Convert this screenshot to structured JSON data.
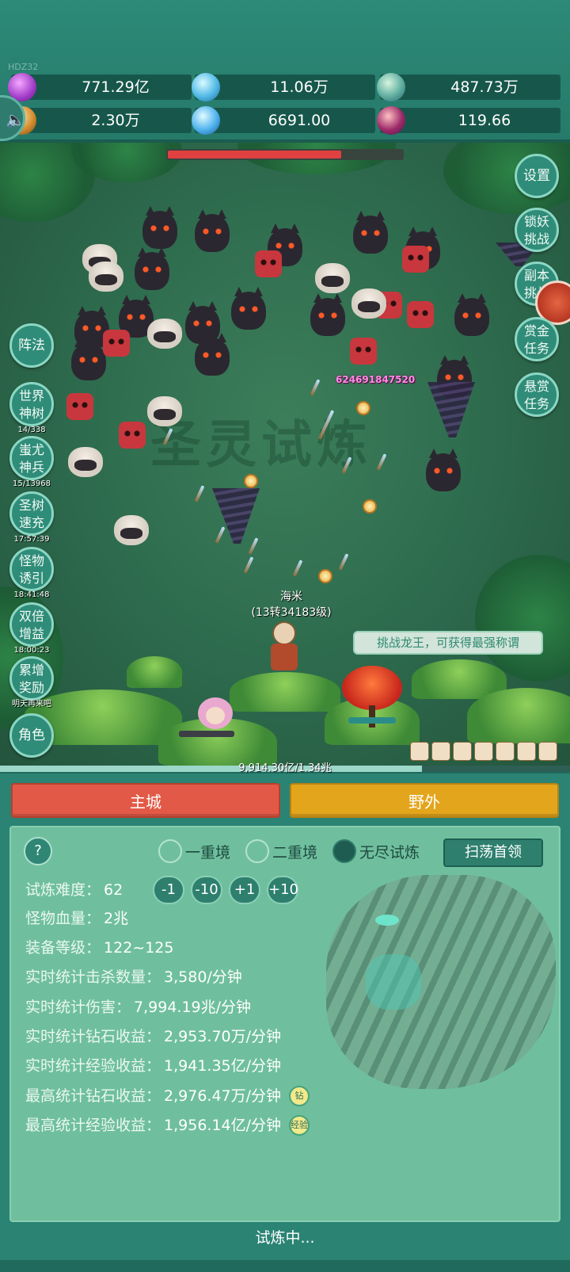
{
  "build_tag": "HDZ32",
  "resources": [
    {
      "icon": "purple-gem-icon",
      "value": "771.29亿"
    },
    {
      "icon": "blue-crystal-icon",
      "value": "11.06万"
    },
    {
      "icon": "world-orb-icon",
      "value": "487.73万"
    },
    {
      "icon": "scroll-icon",
      "value": "2.30万"
    },
    {
      "icon": "ice-shard-icon",
      "value": "6691.00"
    },
    {
      "icon": "potion-pot-icon",
      "value": "119.66"
    }
  ],
  "boss_hp_fraction": 0.74,
  "battle": {
    "watermark": "圣灵试炼",
    "damage_number": "624691847520",
    "hero_name": "海米",
    "hero_level": "(13转34183级)",
    "challenge_tip": "挑战龙王，可获得最强称谓"
  },
  "left_buttons": {
    "zhenfa": "阵法",
    "tree": {
      "l1": "世界",
      "l2": "神树",
      "sub": "14/338"
    },
    "chiyou": {
      "l1": "蚩尤",
      "l2": "神兵",
      "sub": "15/13968"
    },
    "holytree": {
      "l1": "圣树",
      "l2": "速充",
      "sub": "17:57:39"
    },
    "lure": {
      "l1": "怪物",
      "l2": "诱引",
      "sub": "18:41:48"
    },
    "double": {
      "l1": "双倍",
      "l2": "增益",
      "sub": "18:00:23"
    },
    "reward": {
      "l1": "累增",
      "l2": "奖励",
      "sub": "明天再来吧"
    },
    "role": "角色"
  },
  "right_buttons": {
    "settings": "设置",
    "lock": {
      "l1": "锁妖",
      "l2": "挑战"
    },
    "dungeon": {
      "l1": "副本",
      "l2": "挑战"
    },
    "gold": {
      "l1": "赏金",
      "l2": "任务"
    },
    "bounty": {
      "l1": "悬赏",
      "l2": "任务"
    }
  },
  "exp": {
    "text": "9,914.30亿/1.34兆",
    "fraction": 0.74
  },
  "nav": {
    "main": "主城",
    "wild": "野外"
  },
  "panel": {
    "help": "?",
    "modes": [
      {
        "label": "一重境",
        "selected": false
      },
      {
        "label": "二重境",
        "selected": false
      },
      {
        "label": "无尽试炼",
        "selected": true
      }
    ],
    "sweep": "扫荡首领",
    "difficulty": {
      "label": "试炼难度：",
      "value": "62",
      "buttons": [
        "-1",
        "-10",
        "+1",
        "+10"
      ]
    },
    "stats": [
      {
        "label": "怪物血量：",
        "value": "2兆"
      },
      {
        "label": "装备等级：",
        "value": "122~125"
      },
      {
        "label": "实时统计击杀数量：",
        "value": "3,580/分钟"
      },
      {
        "label": "实时统计伤害：",
        "value": "7,994.19兆/分钟"
      },
      {
        "label": "实时统计钻石收益：",
        "value": "2,953.70万/分钟"
      },
      {
        "label": "实时统计经验收益：",
        "value": "1,941.35亿/分钟"
      },
      {
        "label": "最高统计钻石收益：",
        "value": "2,976.47万/分钟",
        "badge": "钻"
      },
      {
        "label": "最高统计经验收益：",
        "value": "1,956.14亿/分钟",
        "badge": "经验"
      }
    ]
  },
  "status": "试炼中..."
}
